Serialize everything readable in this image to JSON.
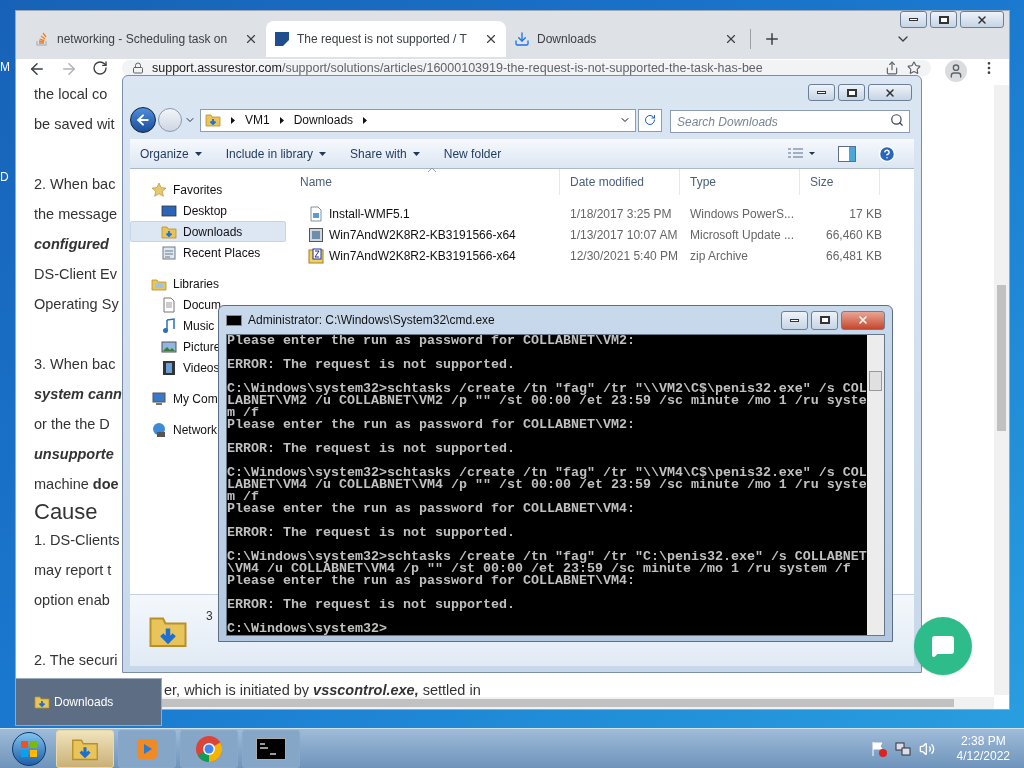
{
  "desktop_icons": [
    {
      "label": "M"
    },
    {
      "label": "D"
    }
  ],
  "browser": {
    "tabs": [
      {
        "title": "networking - Scheduling task on",
        "selected": false
      },
      {
        "title": "The request is not supported / T",
        "selected": true
      },
      {
        "title": "Downloads",
        "selected": false
      }
    ],
    "address": {
      "host": "support.assurestor.com",
      "path": "/support/solutions/articles/16000103919-the-request-is-not-supported-the-task-has-bee"
    },
    "article": [
      {
        "kind": "para",
        "lines": [
          {
            "kind": "text",
            "text": "the local co"
          },
          {
            "kind": "text",
            "text": "be saved wit"
          }
        ]
      },
      {
        "kind": "para",
        "lines": [
          {
            "kind": "text",
            "text": "2. When bac"
          },
          {
            "kind": "text",
            "text": "the message"
          },
          {
            "kind": "emphasis",
            "text": "configured"
          },
          {
            "kind": "text",
            "text": "DS-Client Ev"
          },
          {
            "kind": "text",
            "text": "Operating Sy"
          }
        ]
      },
      {
        "kind": "para",
        "lines": [
          {
            "kind": "text",
            "text": "3. When bac"
          },
          {
            "kind": "emphasis",
            "text": "system cann"
          },
          {
            "kind": "text",
            "text": "or the the D"
          },
          {
            "kind": "emphasis",
            "text": "unsupporte"
          },
          {
            "kind": "text",
            "text": "machine **doe**"
          }
        ]
      },
      {
        "kind": "heading",
        "text": "Cause"
      },
      {
        "kind": "para",
        "lines": [
          {
            "kind": "text",
            "text": "1. DS-Clients"
          },
          {
            "kind": "text",
            "text": "may report t"
          },
          {
            "kind": "text",
            "text": "option enab"
          }
        ]
      },
      {
        "kind": "para",
        "lines": [
          {
            "kind": "text",
            "text": "2. The securi"
          }
        ]
      }
    ],
    "article_tail": [
      {
        "kind": "text",
        "text": "er, which is initiated by "
      },
      {
        "kind": "emphasis",
        "text": "vsscontrol.exe,"
      },
      {
        "kind": "text",
        "text": " settled in"
      }
    ]
  },
  "explorer": {
    "path": [
      "VM1",
      "Downloads"
    ],
    "search_placeholder": "Search Downloads",
    "toolbar": [
      {
        "label": "Organize",
        "dropdown": true
      },
      {
        "label": "Include in library",
        "dropdown": true
      },
      {
        "label": "Share with",
        "dropdown": true
      },
      {
        "label": "New folder",
        "dropdown": false
      }
    ],
    "nav": [
      {
        "label": "Favorites",
        "kind": "header",
        "selected": false
      },
      {
        "label": "Desktop",
        "kind": "item",
        "selected": false
      },
      {
        "label": "Downloads",
        "kind": "item",
        "selected": true
      },
      {
        "label": "Recent Places",
        "kind": "item",
        "selected": false
      },
      {
        "label": "Libraries",
        "kind": "header",
        "selected": false
      },
      {
        "label": "Docum",
        "kind": "item",
        "selected": false
      },
      {
        "label": "Music",
        "kind": "item",
        "selected": false
      },
      {
        "label": "Picture",
        "kind": "item",
        "selected": false
      },
      {
        "label": "Videos",
        "kind": "item",
        "selected": false
      },
      {
        "label": "My Com",
        "kind": "header",
        "selected": false
      },
      {
        "label": "Network",
        "kind": "header",
        "selected": false
      }
    ],
    "columns": [
      "Name",
      "Date modified",
      "Type",
      "Size"
    ],
    "files": [
      {
        "name": "Install-WMF5.1",
        "date": "1/18/2017 3:25 PM",
        "type": "Windows PowerS...",
        "size": "17 KB"
      },
      {
        "name": "Win7AndW2K8R2-KB3191566-x64",
        "date": "1/13/2017 10:07 AM",
        "type": "Microsoft Update ...",
        "size": "66,460 KB"
      },
      {
        "name": "Win7AndW2K8R2-KB3191566-x64",
        "date": "12/30/2021 5:40 PM",
        "type": "zip Archive",
        "size": "66,481 KB"
      }
    ],
    "details_count": "3"
  },
  "cmd": {
    "title": "Administrator: C:\\Windows\\System32\\cmd.exe",
    "blocks": [
      [
        "Please enter the run as password for COLLABNET\\VM2:"
      ],
      [
        "ERROR: The request is not supported."
      ],
      [
        "C:\\Windows\\system32>schtasks /create /tn \"fag\" /tr \"\\\\VM2\\C$\\penis32.exe\" /s COL",
        "LABNET\\VM2 /u COLLABNET\\VM2 /p \"\" /st 00:00 /et 23:59 /sc minute /mo 1 /ru syste",
        "m /f",
        "Please enter the run as password for COLLABNET\\VM2:"
      ],
      [
        "ERROR: The request is not supported."
      ],
      [
        "C:\\Windows\\system32>schtasks /create /tn \"fag\" /tr \"\\\\VM4\\C$\\penis32.exe\" /s COL",
        "LABNET\\VM4 /u COLLABNET\\VM4 /p \"\" /st 00:00 /et 23:59 /sc minute /mo 1 /ru syste",
        "m /f",
        "Please enter the run as password for COLLABNET\\VM4:"
      ],
      [
        "ERROR: The request is not supported."
      ],
      [
        "C:\\Windows\\system32>schtasks /create /tn \"fag\" /tr \"C:\\penis32.exe\" /s COLLABNET",
        "\\VM4 /u COLLABNET\\VM4 /p \"\" /st 00:00 /et 23:59 /sc minute /mo 1 /ru system /f",
        "Please enter the run as password for COLLABNET\\VM4:"
      ],
      [
        "ERROR: The request is not supported."
      ],
      [
        "C:\\Windows\\system32>"
      ]
    ]
  },
  "thumbnail": {
    "label": "Downloads"
  },
  "taskbar": {
    "apps": [
      {
        "kind": "explorer",
        "active": true
      },
      {
        "kind": "media",
        "active": false
      },
      {
        "kind": "chrome",
        "active": false
      },
      {
        "kind": "cmd",
        "active": false
      }
    ],
    "time": "2:38 PM",
    "date": "4/12/2022"
  }
}
